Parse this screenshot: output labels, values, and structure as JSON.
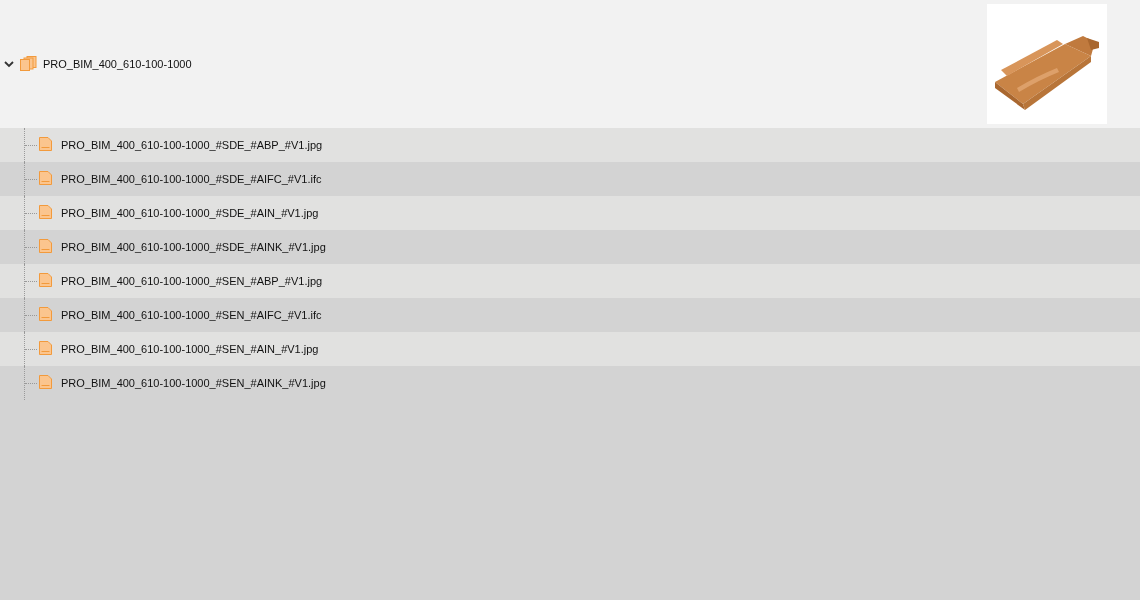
{
  "folder": {
    "name": "PRO_BIM_400_610-100-1000",
    "expanded": true
  },
  "files": [
    {
      "name": "PRO_BIM_400_610-100-1000_#SDE_#ABP_#V1.jpg"
    },
    {
      "name": "PRO_BIM_400_610-100-1000_#SDE_#AIFC_#V1.ifc"
    },
    {
      "name": "PRO_BIM_400_610-100-1000_#SDE_#AIN_#V1.jpg"
    },
    {
      "name": "PRO_BIM_400_610-100-1000_#SDE_#AINK_#V1.jpg"
    },
    {
      "name": "PRO_BIM_400_610-100-1000_#SEN_#ABP_#V1.jpg"
    },
    {
      "name": "PRO_BIM_400_610-100-1000_#SEN_#AIFC_#V1.ifc"
    },
    {
      "name": "PRO_BIM_400_610-100-1000_#SEN_#AIN_#V1.jpg"
    },
    {
      "name": "PRO_BIM_400_610-100-1000_#SEN_#AINK_#V1.jpg"
    }
  ]
}
